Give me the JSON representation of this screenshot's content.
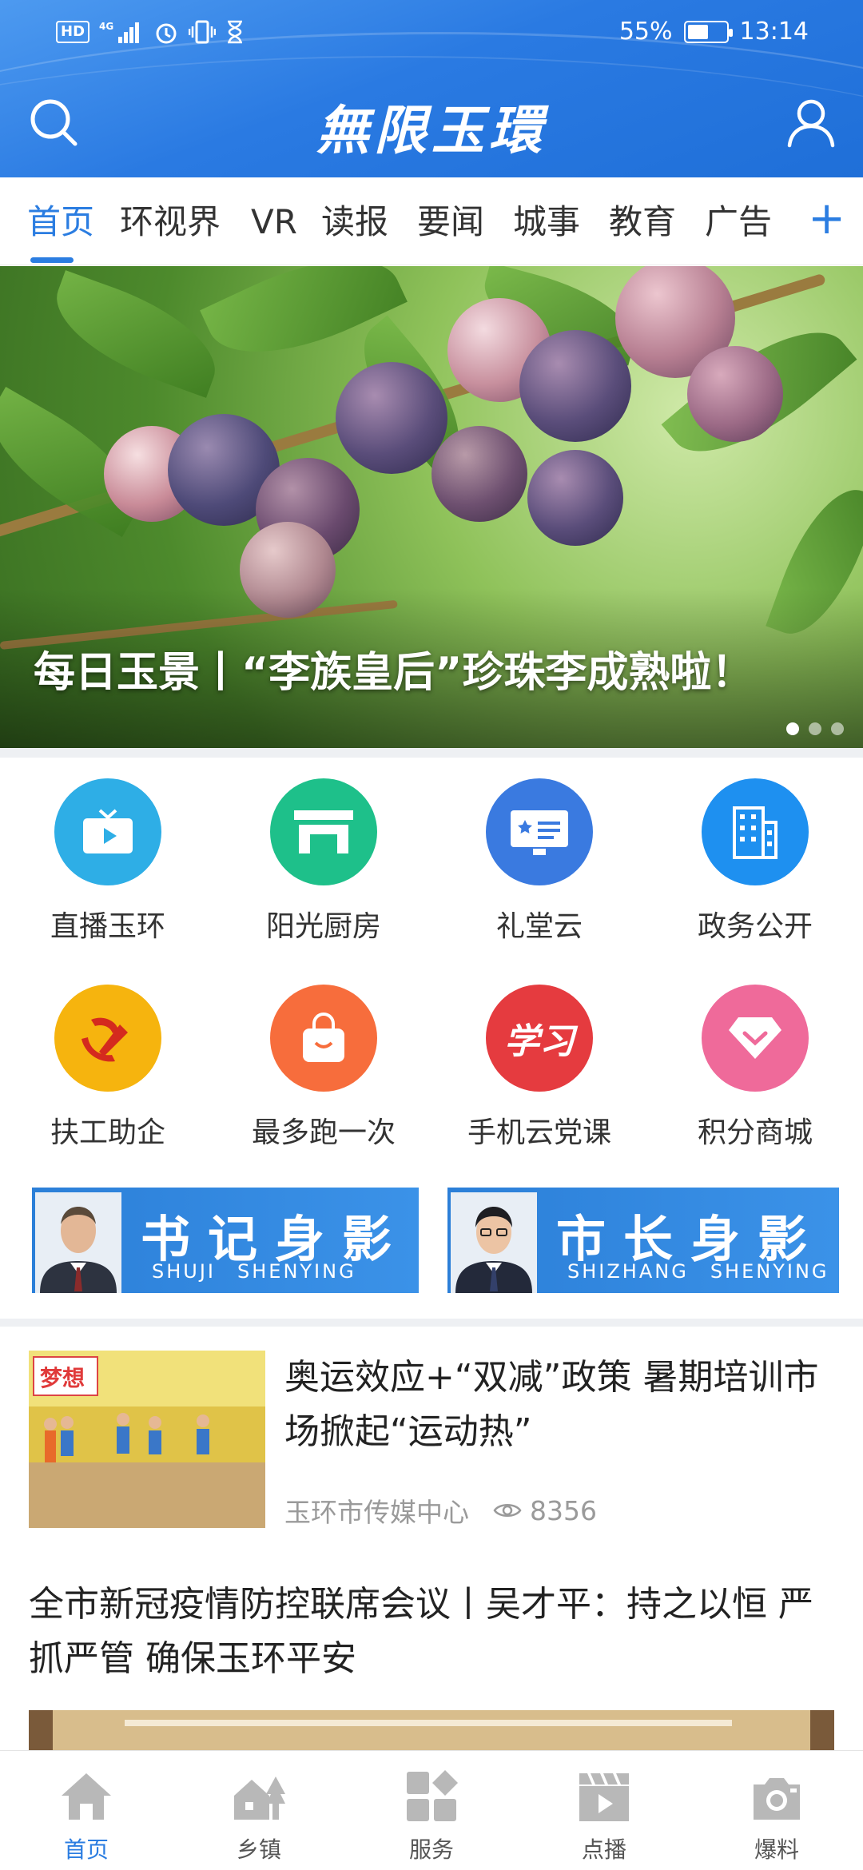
{
  "status_bar": {
    "network": "HD",
    "signal": "4G",
    "battery_percent": "55%",
    "battery_level": 0.55,
    "time": "13:14"
  },
  "header": {
    "logo_text": "無限玉環"
  },
  "tabs": [
    {
      "label": "首页",
      "active": true
    },
    {
      "label": "环视界"
    },
    {
      "label": "VR"
    },
    {
      "label": "读报"
    },
    {
      "label": "要闻"
    },
    {
      "label": "城事"
    },
    {
      "label": "教育"
    },
    {
      "label": "广告"
    }
  ],
  "tabs_more": "+",
  "banner": {
    "caption": "每日玉景丨“李族皇后”珍珠李成熟啦！",
    "slide_index": 1,
    "slide_count": 3
  },
  "services": [
    {
      "label": "直播玉环",
      "icon": "tv-icon",
      "color": "#2eaee6"
    },
    {
      "label": "阳光厨房",
      "icon": "kitchen-icon",
      "color": "#1ec08a"
    },
    {
      "label": "礼堂云",
      "icon": "screen-star-icon",
      "color": "#3a7ae0"
    },
    {
      "label": "政务公开",
      "icon": "building-icon",
      "color": "#1e90f0"
    },
    {
      "label": "扶工助企",
      "icon": "party-emblem-icon",
      "color": "#f6b40e"
    },
    {
      "label": "最多跑一次",
      "icon": "shopping-bag-icon",
      "color": "#f76d3c"
    },
    {
      "label": "手机云党课",
      "icon": "xuexi-icon",
      "color": "#e53b3f",
      "icon_text": "学习"
    },
    {
      "label": "积分商城",
      "icon": "diamond-icon",
      "color": "#ef6a9a"
    }
  ],
  "leaders": [
    {
      "title": "书记身影",
      "pinyin": "SHUJI　SHENYING"
    },
    {
      "title": "市长身影",
      "pinyin": "SHIZHANG　SHENYING"
    }
  ],
  "news": [
    {
      "title": "奥运效应+“双减”政策  暑期培训市场掀起“运动热”",
      "source": "玉环市传媒中心",
      "views": "8356",
      "thumb_text": "梦想"
    },
    {
      "title": "全市新冠疫情防控联席会议丨吴才平：持之以恒 严抓严管 确保玉环平安"
    }
  ],
  "bottom_nav": [
    {
      "label": "首页",
      "icon": "home-icon",
      "active": true
    },
    {
      "label": "乡镇",
      "icon": "town-icon"
    },
    {
      "label": "服务",
      "icon": "services-grid-icon"
    },
    {
      "label": "点播",
      "icon": "video-clapper-icon"
    },
    {
      "label": "爆料",
      "icon": "camera-icon"
    }
  ],
  "colors": {
    "brand": "#2b7de1",
    "header": "#2a7ae2"
  }
}
